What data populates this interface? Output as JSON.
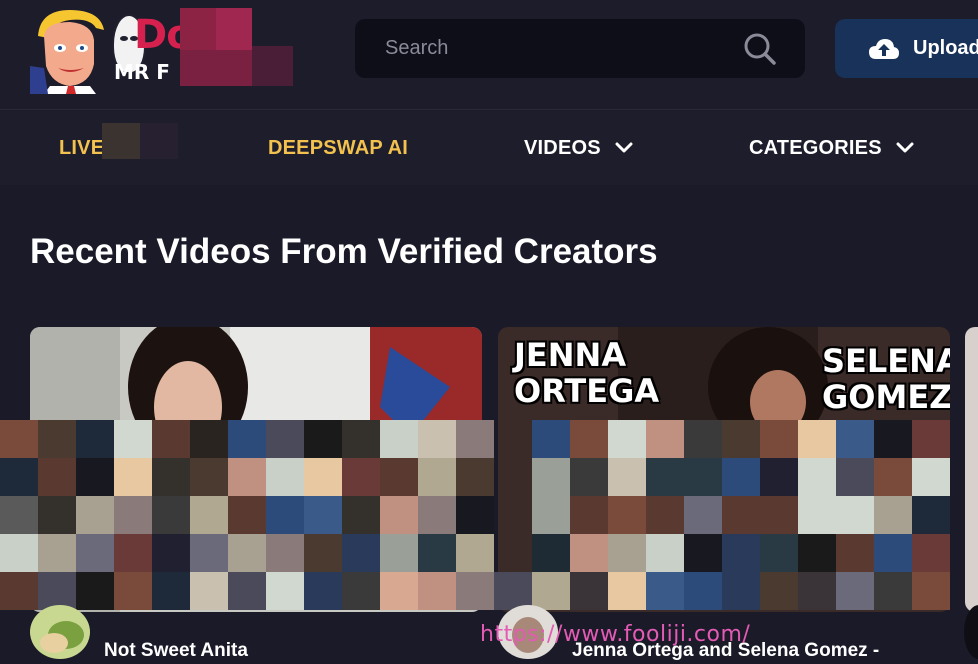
{
  "header": {
    "logo_top": "Do",
    "logo_bottom": "MR F",
    "search_placeholder": "Search",
    "upload_label": "Upload"
  },
  "nav": {
    "items": [
      {
        "label": "LIVE",
        "color": "#f2c14e"
      },
      {
        "label": "DEEPSWAP AI",
        "color": "#f2c14e"
      },
      {
        "label": "VIDEOS",
        "color": "#ffffff",
        "dropdown": true
      },
      {
        "label": "CATEGORIES",
        "color": "#ffffff",
        "dropdown": true
      }
    ]
  },
  "main": {
    "section_title": "Recent Videos From Verified Creators",
    "cards": [
      {
        "overlay_lines": "",
        "title": "Not Sweet Anita"
      },
      {
        "overlay_left": "JENNA\nORTEGA",
        "overlay_right": "SELENA\nGOMEZ",
        "title": "Jenna Ortega and Selena Gomez -"
      }
    ]
  },
  "watermark": "https://www.fooliji.com/",
  "colors": {
    "background": "#1a1a29",
    "accent_yellow": "#f2c14e",
    "upload_blue": "#183259",
    "search_bg": "#0e0e19",
    "logo_red": "#d6214f"
  }
}
